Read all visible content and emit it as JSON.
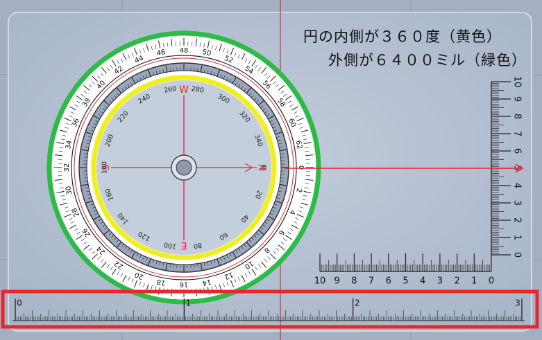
{
  "caption": {
    "line1": "円の内側が３６０度（黄色）",
    "line2": "外側が６４００ミル（緑色）"
  },
  "compass": {
    "inner_labels": [
      "0",
      "20",
      "40",
      "60",
      "80",
      "100",
      "120",
      "140",
      "160",
      "180",
      "200",
      "220",
      "240",
      "260",
      "280",
      "300",
      "320",
      "340"
    ],
    "outer_labels": [
      "0",
      "2",
      "4",
      "6",
      "8",
      "10",
      "12",
      "14",
      "16",
      "18",
      "20",
      "22",
      "24",
      "26",
      "28",
      "30",
      "32",
      "34",
      "36",
      "38",
      "40",
      "42",
      "44",
      "46",
      "48",
      "50",
      "52",
      "54",
      "56",
      "58",
      "60",
      "62"
    ],
    "cardinals": {
      "north": "N",
      "south": "S",
      "east": "E",
      "west": "W"
    },
    "colors": {
      "degree_ring": "#f2ee1c",
      "mil_ring": "#2dbb47",
      "cross": "#e8262e"
    }
  },
  "vertical_ruler": {
    "labels": [
      "0",
      "1",
      "2",
      "3",
      "4",
      "5",
      "6",
      "7",
      "8",
      "9",
      "10"
    ]
  },
  "horizontal_ruler": {
    "labels": [
      "10",
      "9",
      "8",
      "7",
      "6",
      "5",
      "4",
      "3",
      "2",
      "1",
      "0"
    ]
  },
  "bottom_ruler": {
    "labels": [
      "0",
      "1",
      "2",
      "3"
    ],
    "highlight_color": "#e8262e"
  }
}
